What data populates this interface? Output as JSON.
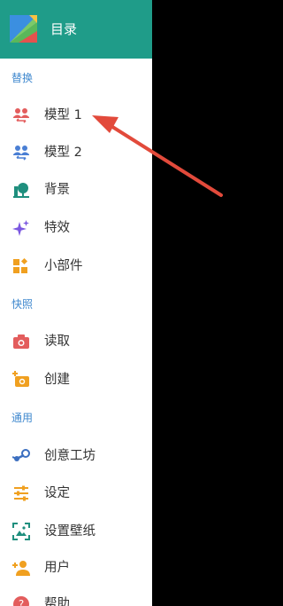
{
  "drawer": {
    "title": "目录",
    "sections": [
      {
        "header": "替换",
        "items": [
          {
            "label": "模型 1",
            "icon": "people-swap-red-icon",
            "color": "#e35d5d"
          },
          {
            "label": "模型 2",
            "icon": "people-swap-blue-icon",
            "color": "#4a7fd4"
          },
          {
            "label": "背景",
            "icon": "tree-landscape-icon",
            "color": "#1f8f7e"
          },
          {
            "label": "特效",
            "icon": "sparkle-icon",
            "color": "#7b57e0"
          },
          {
            "label": "小部件",
            "icon": "widgets-icon",
            "color": "#f0a020"
          }
        ]
      },
      {
        "header": "快照",
        "items": [
          {
            "label": "读取",
            "icon": "camera-icon",
            "color": "#e35d5d"
          },
          {
            "label": "创建",
            "icon": "add-camera-icon",
            "color": "#f0a020"
          }
        ]
      },
      {
        "header": "通用",
        "items": [
          {
            "label": "创意工坊",
            "icon": "steam-icon",
            "color": "#3c6fc0"
          },
          {
            "label": "设定",
            "icon": "sliders-icon",
            "color": "#f0a020"
          },
          {
            "label": "设置壁纸",
            "icon": "wallpaper-icon",
            "color": "#1f8f7e"
          },
          {
            "label": "用户",
            "icon": "add-user-icon",
            "color": "#f0a020"
          },
          {
            "label": "帮助",
            "icon": "help-icon",
            "color": "#e35d5d"
          }
        ]
      }
    ]
  },
  "colors": {
    "header_bg": "#1f9c89",
    "section_header": "#3f88ce",
    "arrow": "#e24a3b",
    "backdrop": "#000000"
  }
}
